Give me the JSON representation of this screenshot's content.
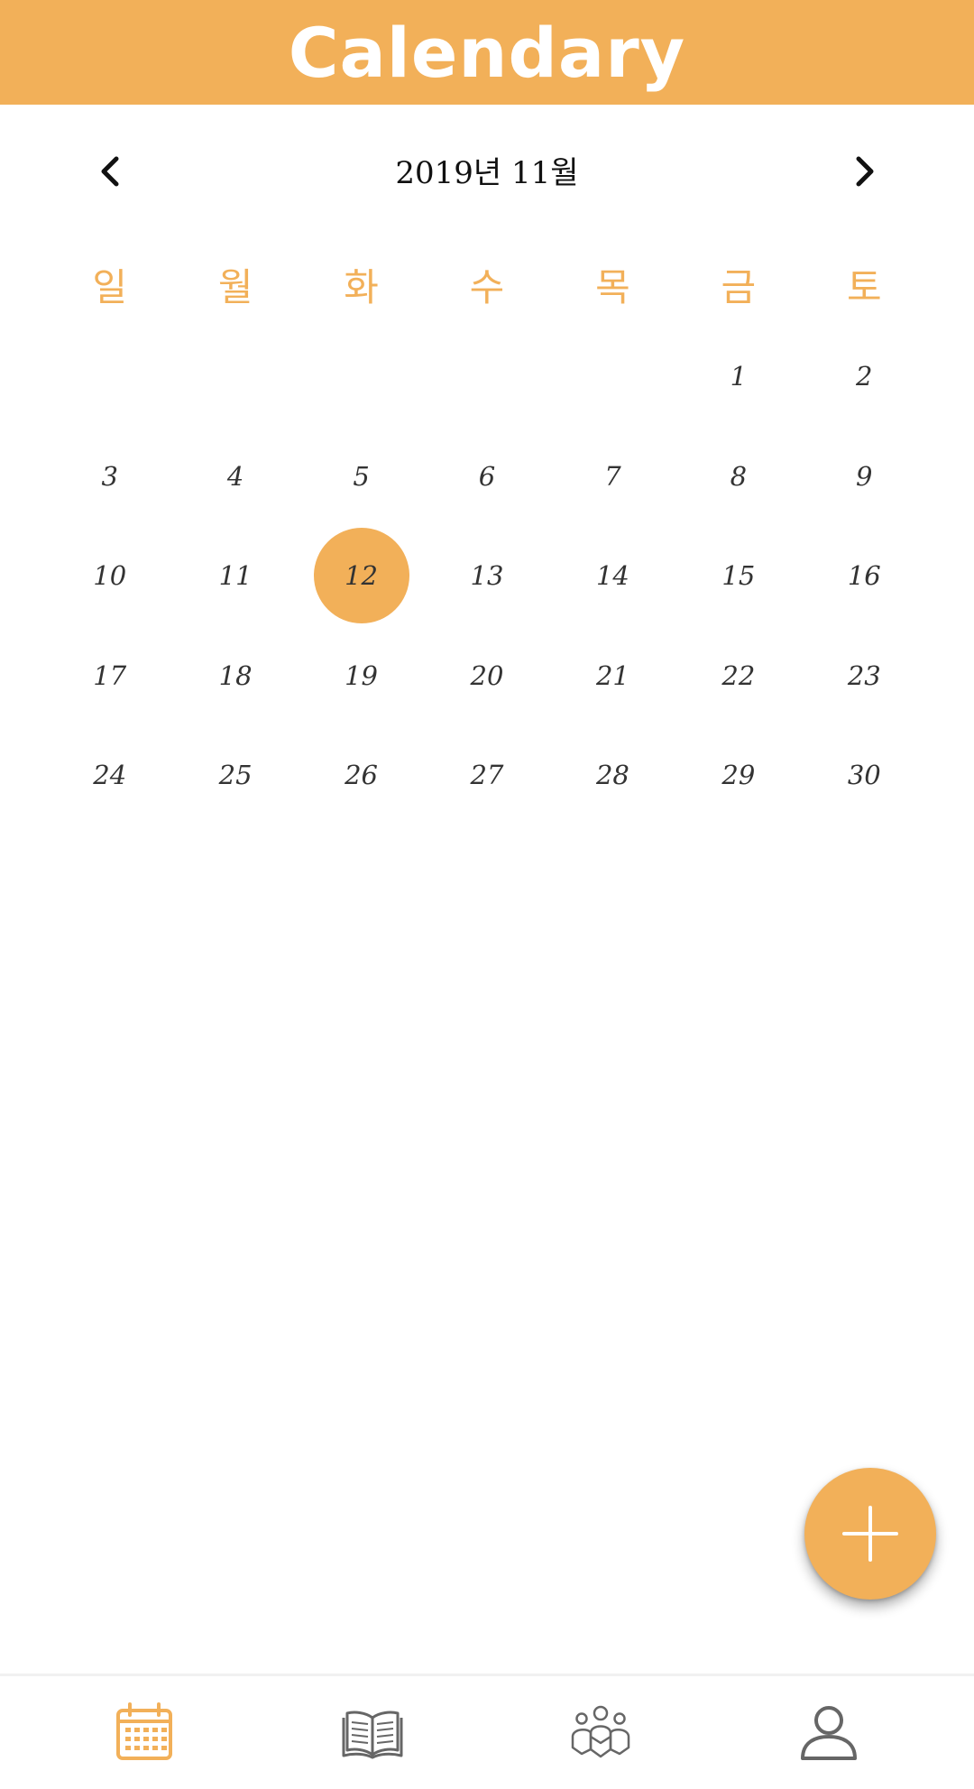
{
  "header": {
    "title": "Calendary"
  },
  "month_nav": {
    "label": "2019년 11월",
    "prev_icon": "chevron-left-icon",
    "next_icon": "chevron-right-icon"
  },
  "weekdays": [
    "일",
    "월",
    "화",
    "수",
    "목",
    "금",
    "토"
  ],
  "days": [
    "",
    "",
    "",
    "",
    "",
    "1",
    "2",
    "3",
    "4",
    "5",
    "6",
    "7",
    "8",
    "9",
    "10",
    "11",
    "12",
    "13",
    "14",
    "15",
    "16",
    "17",
    "18",
    "19",
    "20",
    "21",
    "22",
    "23",
    "24",
    "25",
    "26",
    "27",
    "28",
    "29",
    "30"
  ],
  "selected_day": "12",
  "fab": {
    "icon": "plus-icon"
  },
  "bottom_nav": {
    "items": [
      {
        "icon": "calendar-icon",
        "active": true
      },
      {
        "icon": "book-icon",
        "active": false
      },
      {
        "icon": "group-icon",
        "active": false
      },
      {
        "icon": "user-icon",
        "active": false
      }
    ]
  },
  "colors": {
    "accent": "#f2b059",
    "text": "#333333",
    "icon_inactive": "#666666",
    "white": "#ffffff"
  }
}
